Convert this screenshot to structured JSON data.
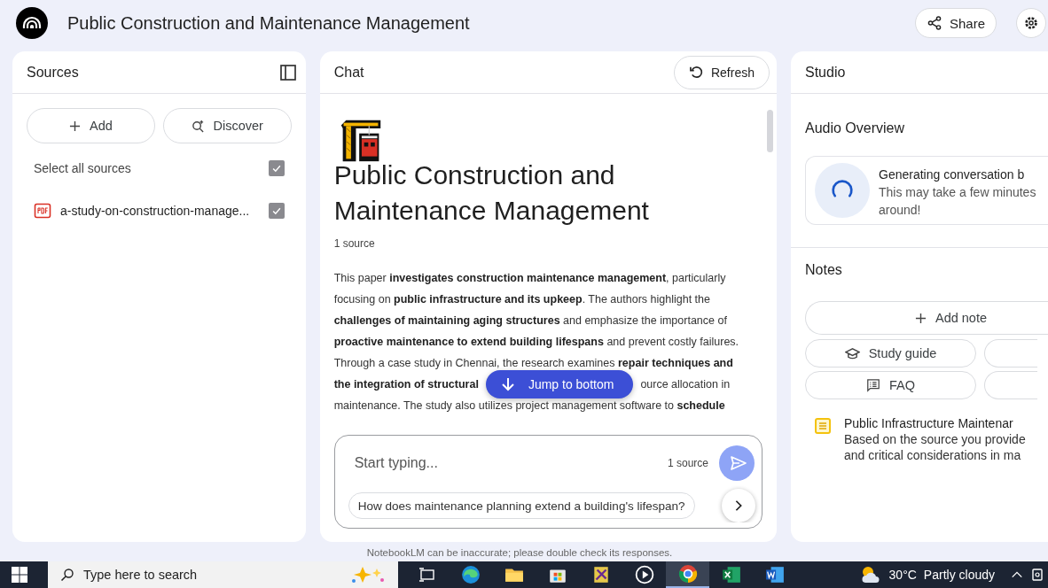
{
  "header": {
    "title": "Public Construction and Maintenance Management",
    "share": "Share"
  },
  "sources": {
    "title": "Sources",
    "buttons": [
      {
        "kind": "add",
        "label": "Add"
      },
      {
        "kind": "discover",
        "label": "Discover"
      }
    ],
    "select_all": {
      "label": "Select all sources",
      "checked": true
    },
    "items": [
      {
        "kind": "pdf",
        "name": "a-study-on-construction-manage...",
        "checked": true
      }
    ]
  },
  "chat": {
    "title": "Chat",
    "refresh": "Refresh",
    "notebook_title": "Public Construction and Maintenance Management",
    "source_count": "1 source",
    "summary_lines": [
      [
        "This paper **investigates construction maintenance management**, particularly"
      ],
      [
        "focusing on **public infrastructure and its upkeep**. The authors highlight the"
      ],
      [
        "**challenges of maintaining aging structures** and emphasize the importance of"
      ],
      [
        "**proactive maintenance to extend building lifespans** and prevent costly failures."
      ],
      [
        "Through a case study in Chennai, the research examines **repair techniques and**"
      ],
      [
        "**the integration of structural**",
        "ource allocation in"
      ],
      [
        "maintenance. The study also utilizes project management software to **schedule**"
      ]
    ],
    "jump": "Jump to bottom",
    "input": {
      "placeholder": "Start typing...",
      "source_count": "1 source"
    },
    "suggestions": [
      {
        "kind": "full",
        "label": "How does maintenance planning extend a building's lifespan?"
      }
    ]
  },
  "studio": {
    "title": "Studio",
    "audio_title": "Audio Overview",
    "audio": {
      "title": "Generating conversation b",
      "lines": [
        "This may take a few minutes",
        "around!"
      ]
    },
    "notes_title": "Notes",
    "add_note": "Add note",
    "chips": [
      {
        "kind": "study",
        "label": "Study guide"
      },
      {
        "kind": "cut"
      },
      {
        "kind": "faq",
        "label": "FAQ"
      },
      {
        "kind": "cut"
      }
    ],
    "notes": [
      {
        "title": "Public Infrastructure Maintenar",
        "lines": [
          "Based on the source you provide",
          "and critical considerations in ma"
        ]
      }
    ]
  },
  "disclaimer": "NotebookLM can be inaccurate; please double check its responses.",
  "taskbar": {
    "search": "Type here to search",
    "apps": [
      {
        "kind": "taskview",
        "selected": false
      },
      {
        "kind": "edge",
        "selected": false
      },
      {
        "kind": "folder",
        "selected": false
      },
      {
        "kind": "store",
        "selected": false
      },
      {
        "kind": "tool",
        "selected": false
      },
      {
        "kind": "player",
        "selected": false
      },
      {
        "kind": "chrome",
        "selected": true
      },
      {
        "kind": "excel",
        "selected": false
      },
      {
        "kind": "word",
        "selected": false
      }
    ],
    "weather": {
      "temp": "30°C",
      "condition": "Partly cloudy"
    }
  }
}
